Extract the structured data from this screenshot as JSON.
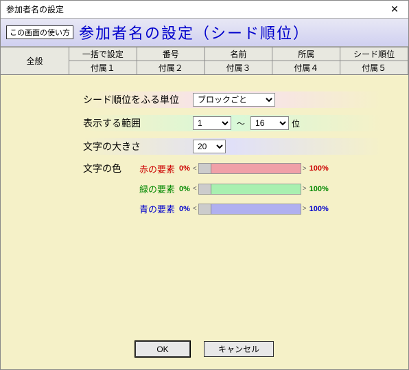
{
  "window": {
    "title": "参加者名の設定"
  },
  "header": {
    "usage_button": "この画面の使い方",
    "title": "参加者名の設定（シード順位）"
  },
  "tabs": {
    "general": "全般",
    "row1": [
      "一括で設定",
      "番号",
      "名前",
      "所属",
      "シード順位"
    ],
    "row2": [
      "付属１",
      "付属２",
      "付属３",
      "付属４",
      "付属５"
    ]
  },
  "form": {
    "seed_unit_label": "シード順位をふる単位",
    "seed_unit_value": "ブロックごと",
    "range_label": "表示する範囲",
    "range_from": "1",
    "range_sep": "～",
    "range_to": "16",
    "range_unit": "位",
    "font_size_label": "文字の大きさ",
    "font_size_value": "20",
    "color_label": "文字の色",
    "red_label": "赤の要素",
    "green_label": "緑の要素",
    "blue_label": "青の要素",
    "pct0": "0%",
    "pct100": "100%"
  },
  "buttons": {
    "ok": "OK",
    "cancel": "キャンセル"
  }
}
